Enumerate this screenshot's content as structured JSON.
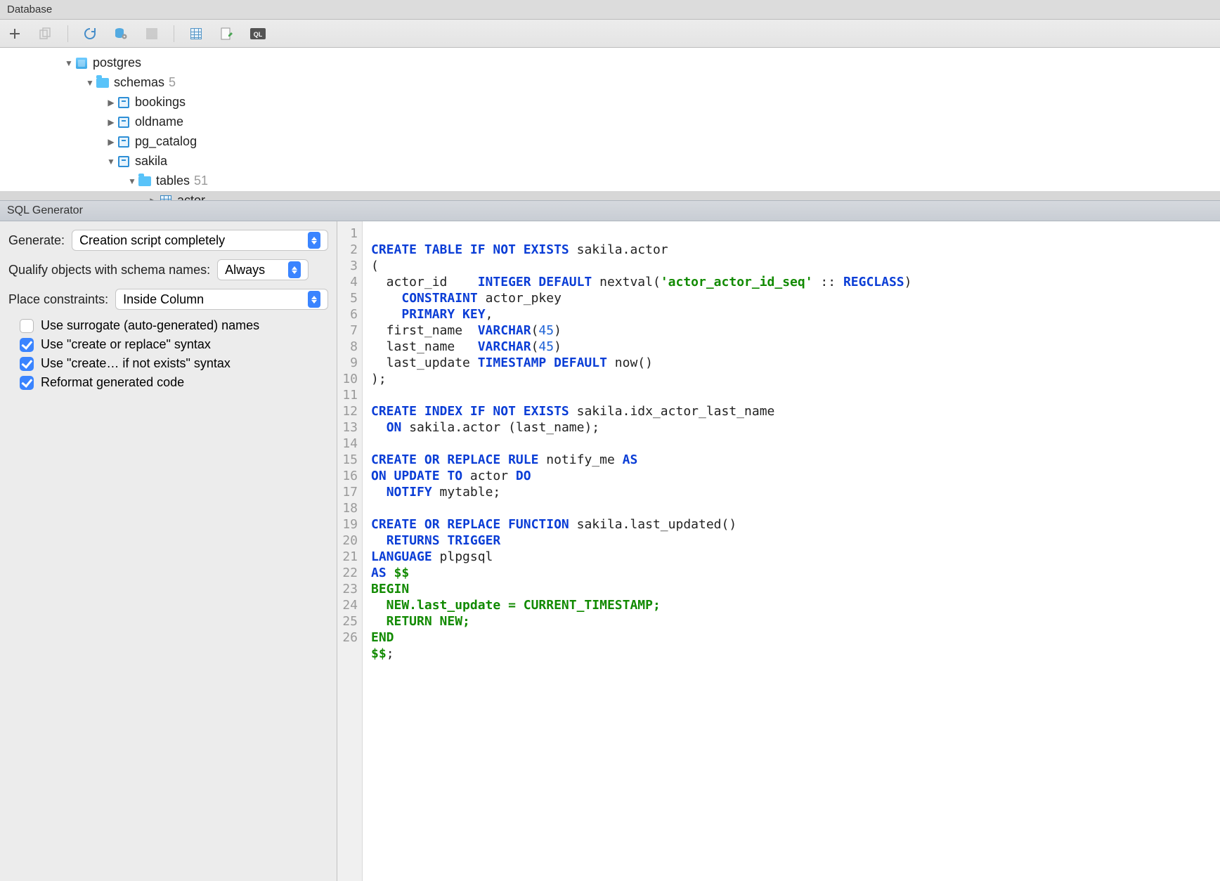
{
  "titles": {
    "database": "Database",
    "sqlgen": "SQL Generator"
  },
  "tree": {
    "postgres": "postgres",
    "schemas": "schemas",
    "schemas_count": "5",
    "bookings": "bookings",
    "oldname": "oldname",
    "pg_catalog": "pg_catalog",
    "sakila": "sakila",
    "tables": "tables",
    "tables_count": "51",
    "actor": "actor"
  },
  "form": {
    "generate_label": "Generate:",
    "generate_value": "Creation script completely",
    "qualify_label": "Qualify objects with schema names:",
    "qualify_value": "Always",
    "place_label": "Place constraints:",
    "place_value": "Inside Column",
    "chk_surrogate": "Use surrogate (auto-generated) names",
    "chk_coreplace": "Use \"create or replace\" syntax",
    "chk_ifnotexists": "Use \"create… if not exists\" syntax",
    "chk_reformat": "Reformat generated code"
  },
  "code_lines": 26,
  "sql": {
    "l1a": "CREATE TABLE IF NOT EXISTS",
    "l1b": " sakila.actor",
    "l2": "(",
    "l3a": "  actor_id    ",
    "l3b": "INTEGER DEFAULT",
    "l3c": " nextval(",
    "l3d": "'actor_actor_id_seq'",
    "l3e": " :: ",
    "l3f": "REGCLASS",
    "l3g": ")",
    "l4a": "    ",
    "l4b": "CONSTRAINT",
    "l4c": " actor_pkey",
    "l5a": "    ",
    "l5b": "PRIMARY KEY",
    "l5c": ",",
    "l6a": "  first_name  ",
    "l6b": "VARCHAR",
    "l6c": "(",
    "l6d": "45",
    "l6e": ")",
    "l7a": "  last_name   ",
    "l7b": "VARCHAR",
    "l7c": "(",
    "l7d": "45",
    "l7e": ")",
    "l8a": "  last_update ",
    "l8b": "TIMESTAMP DEFAULT",
    "l8c": " now()",
    "l9": ");",
    "l10": "",
    "l11a": "CREATE INDEX IF NOT EXISTS",
    "l11b": " sakila.idx_actor_last_name",
    "l12a": "  ",
    "l12b": "ON",
    "l12c": " sakila.actor (last_name);",
    "l13": "",
    "l14a": "CREATE OR REPLACE RULE",
    "l14b": " notify_me ",
    "l14c": "AS",
    "l15a": "ON UPDATE TO",
    "l15b": " actor ",
    "l15c": "DO",
    "l16a": "  ",
    "l16b": "NOTIFY",
    "l16c": " mytable;",
    "l17": "",
    "l18a": "CREATE OR REPLACE FUNCTION",
    "l18b": " sakila.last_updated()",
    "l19a": "  ",
    "l19b": "RETURNS TRIGGER",
    "l20a": "LANGUAGE",
    "l20b": " plpgsql",
    "l21a": "AS ",
    "l21b": "$$",
    "l22": "BEGIN",
    "l23": "  NEW.last_update = CURRENT_TIMESTAMP;",
    "l24": "  RETURN NEW;",
    "l25": "END",
    "l26a": "$$",
    "l26b": ";"
  }
}
